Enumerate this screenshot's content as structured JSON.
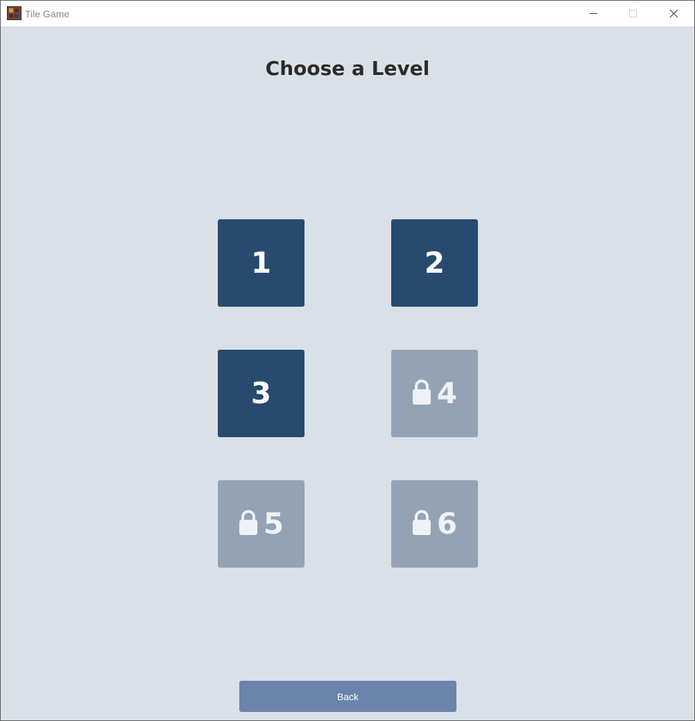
{
  "window": {
    "title": "Tile Game",
    "app_icon": "tile-game-icon",
    "controls": [
      "minimize-icon",
      "maximize-icon",
      "close-icon"
    ]
  },
  "page": {
    "heading": "Choose a Level"
  },
  "levels": [
    {
      "label": "1",
      "locked": false
    },
    {
      "label": "2",
      "locked": false
    },
    {
      "label": "3",
      "locked": false
    },
    {
      "label": "4",
      "locked": true,
      "icon": "lock-icon"
    },
    {
      "label": "5",
      "locked": true,
      "icon": "lock-icon"
    },
    {
      "label": "6",
      "locked": true,
      "icon": "lock-icon"
    }
  ],
  "footer": {
    "back_label": "Back"
  },
  "colors": {
    "background": "#dae0e7",
    "tile_unlocked": "#284a6f",
    "tile_locked": "#93a3b5",
    "back_button": "#6b84ac"
  }
}
